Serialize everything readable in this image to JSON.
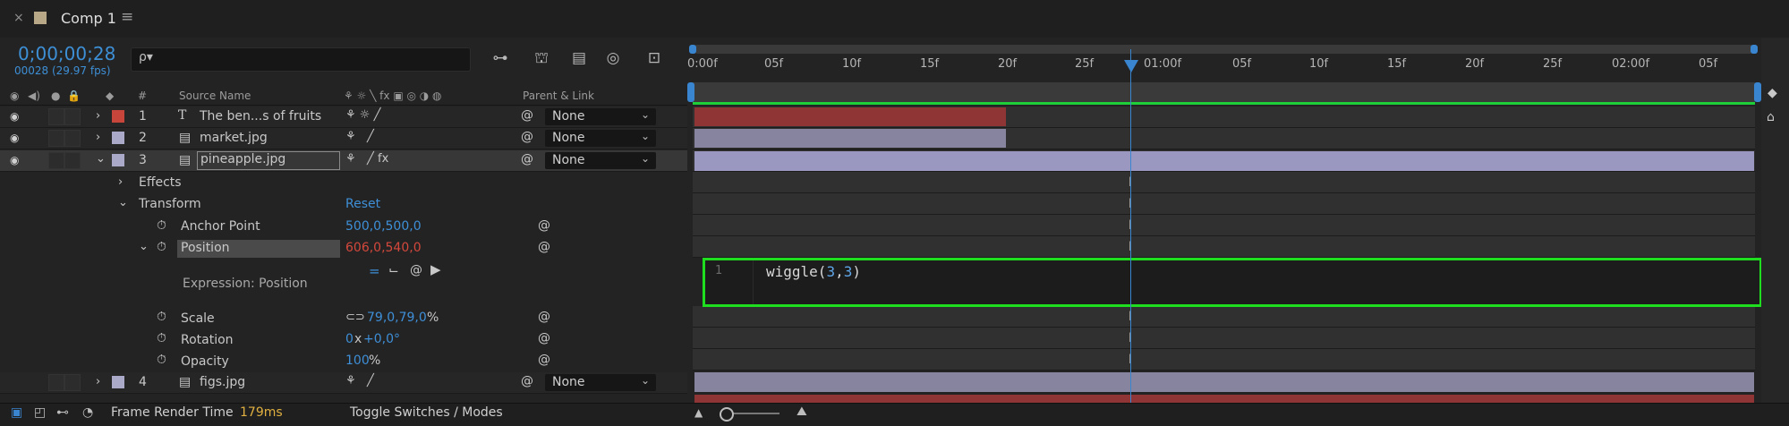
{
  "tab": {
    "close": "×",
    "title": "Comp 1",
    "menu": "≡"
  },
  "timecode": "0;00;00;28",
  "timecode_sub": "00028 (29.97 fps)",
  "search": {
    "placeholder": "ρ▾"
  },
  "toolbar_icons": [
    "flowchart-icon",
    "shy-layer-icon",
    "frame-blend-icon",
    "motion-blur-icon",
    "graph-editor-icon"
  ],
  "columns": {
    "source_name": "Source Name",
    "hash": "#",
    "parent_link": "Parent & Link"
  },
  "layers": [
    {
      "num": "1",
      "type": "T",
      "name": "The ben...s of fruits",
      "parent": "None",
      "label_color": "#c8453c"
    },
    {
      "num": "2",
      "type": "file",
      "name": "market.jpg",
      "parent": "None",
      "label_color": "#aaaac8"
    },
    {
      "num": "3",
      "type": "file",
      "name": "pineapple.jpg",
      "parent": "None",
      "label_color": "#aaaac8"
    },
    {
      "num": "4",
      "type": "file",
      "name": "figs.jpg",
      "parent": "None",
      "label_color": "#aaaac8"
    }
  ],
  "props": {
    "effects": "Effects",
    "transform": "Transform",
    "reset": "Reset",
    "anchor_point": {
      "name": "Anchor Point",
      "value": "500,0,500,0"
    },
    "position": {
      "name": "Position",
      "value": "606,0,540,0"
    },
    "expression_label": "Expression: Position",
    "scale": {
      "name": "Scale",
      "value": "79,0,79,0",
      "unit": "%"
    },
    "rotation": {
      "name": "Rotation",
      "value_a": "0",
      "mid": "x",
      "value_b": "+0,0°"
    },
    "opacity": {
      "name": "Opacity",
      "value": "100",
      "unit": "%"
    }
  },
  "ruler": [
    "0:00f",
    "05f",
    "10f",
    "15f",
    "20f",
    "25f",
    "01:00f",
    "05f",
    "10f",
    "15f",
    "20f",
    "25f",
    "02:00f",
    "05f"
  ],
  "expression": {
    "line_number": "1",
    "code_fn": "wiggle(",
    "code_arg1": "3",
    "code_sep": ",",
    "code_arg2": "3",
    "code_close": ")"
  },
  "status": {
    "frame_render_label": "Frame Render Time",
    "frame_render_value": "179ms",
    "toggle": "Toggle Switches / Modes"
  },
  "colors": {
    "accent": "#3a85d0",
    "highlight": "#1fdd1f",
    "red_layer": "#8f3535",
    "lavender_layer": "#9a98c0"
  }
}
